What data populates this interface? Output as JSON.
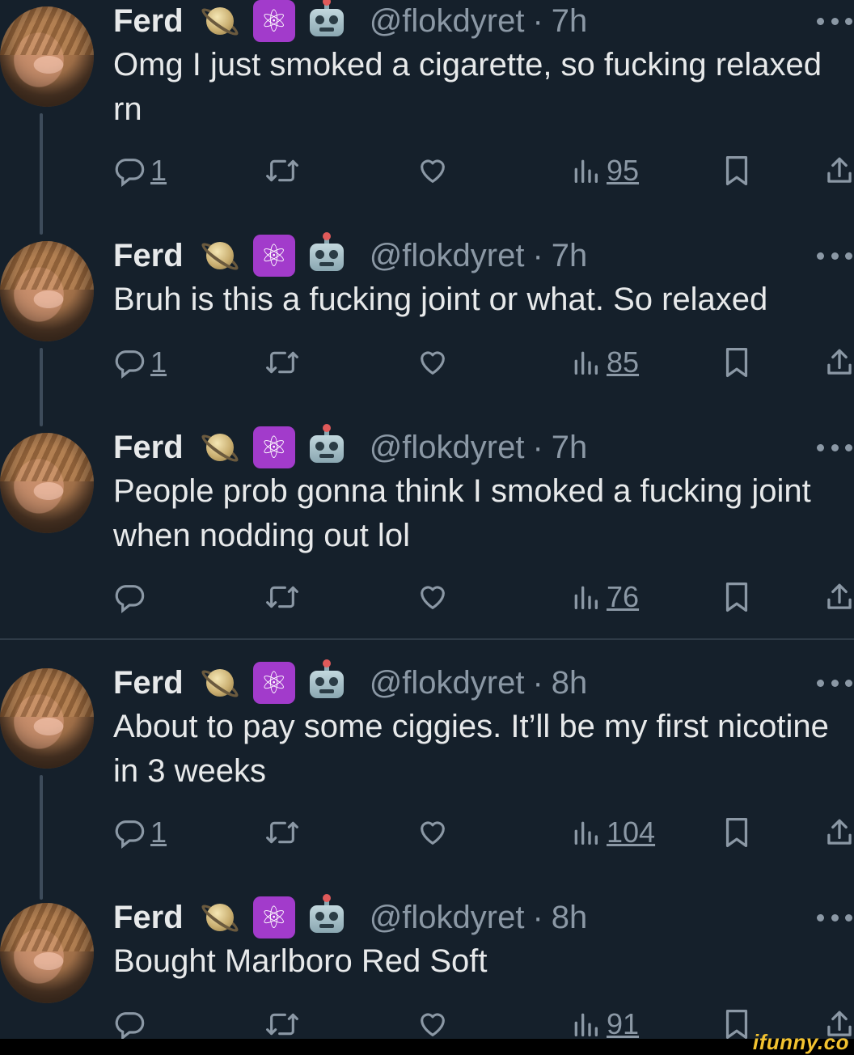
{
  "tweets": [
    {
      "name": "Ferd",
      "handle": "@flokdyret",
      "time": "7h",
      "text": "Omg I just smoked a cigarette, so fucking relaxed rn",
      "replies": "1",
      "views": "95"
    },
    {
      "name": "Ferd",
      "handle": "@flokdyret",
      "time": "7h",
      "text": "Bruh is this a fucking joint or what. So relaxed",
      "replies": "1",
      "views": "85"
    },
    {
      "name": "Ferd",
      "handle": "@flokdyret",
      "time": "7h",
      "text": "People prob gonna think I smoked a fucking joint when nodding out lol",
      "replies": "",
      "views": "76"
    },
    {
      "name": "Ferd",
      "handle": "@flokdyret",
      "time": "8h",
      "text": "About to pay some ciggies. It’ll be my first nicotine in 3 weeks",
      "replies": "1",
      "views": "104"
    },
    {
      "name": "Ferd",
      "handle": "@flokdyret",
      "time": "8h",
      "text": "Bought Marlboro Red Soft",
      "replies": "",
      "views": "91"
    }
  ],
  "name_emojis": [
    "ringed-planet-icon",
    "atom-symbol-icon",
    "robot-icon"
  ],
  "separator": "·",
  "watermark": "ifunny.co",
  "colors": {
    "background": "#15202b",
    "text": "#e7e9ea",
    "muted": "#8b98a5",
    "watermark": "#f2c230"
  }
}
